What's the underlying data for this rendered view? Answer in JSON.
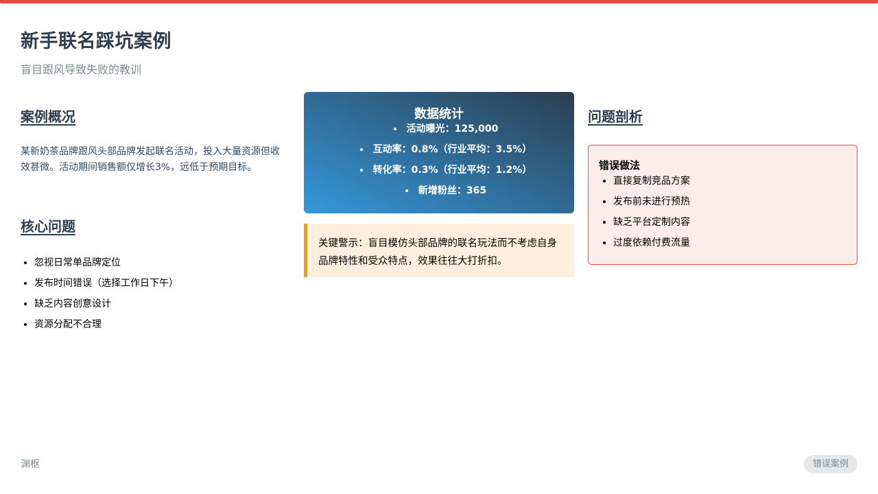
{
  "header": {
    "title": "新手联名踩坑案例",
    "subtitle": "盲目跟风导致失败的教训"
  },
  "overview": {
    "heading": "案例概况",
    "text": "某新奶茶品牌跟风头部品牌发起联名活动，投入大量资源但收效甚微。活动期间销售额仅增长3%，远低于预期目标。"
  },
  "core_issues": {
    "heading": "核心问题",
    "items": [
      "忽视日常单品牌定位",
      "发布时间错误（选择工作日下午）",
      "缺乏内容创意设计",
      "资源分配不合理"
    ]
  },
  "stats": {
    "title": "数据统计",
    "items": [
      "活动曝光：125,000",
      "互动率：0.8%（行业平均：3.5%）",
      "转化率：0.3%（行业平均：1.2%）",
      "新增粉丝：365"
    ]
  },
  "warning": {
    "text": "关键警示：盲目模仿头部品牌的联名玩法而不考虑自身品牌特性和受众特点，效果往往大打折扣。"
  },
  "analysis": {
    "heading": "问题剖析",
    "mistakes_title": "错误做法",
    "items": [
      "直接复制竞品方案",
      "发布前未进行预热",
      "缺乏平台定制内容",
      "过度依赖付费流量"
    ]
  },
  "footer": {
    "brand": "渊枢",
    "badge": "错误案例"
  },
  "colors": {
    "accent_red": "#e74c3c",
    "warning_orange": "#f39c12",
    "dark_blue": "#2c3e50",
    "light_blue": "#3498db"
  }
}
